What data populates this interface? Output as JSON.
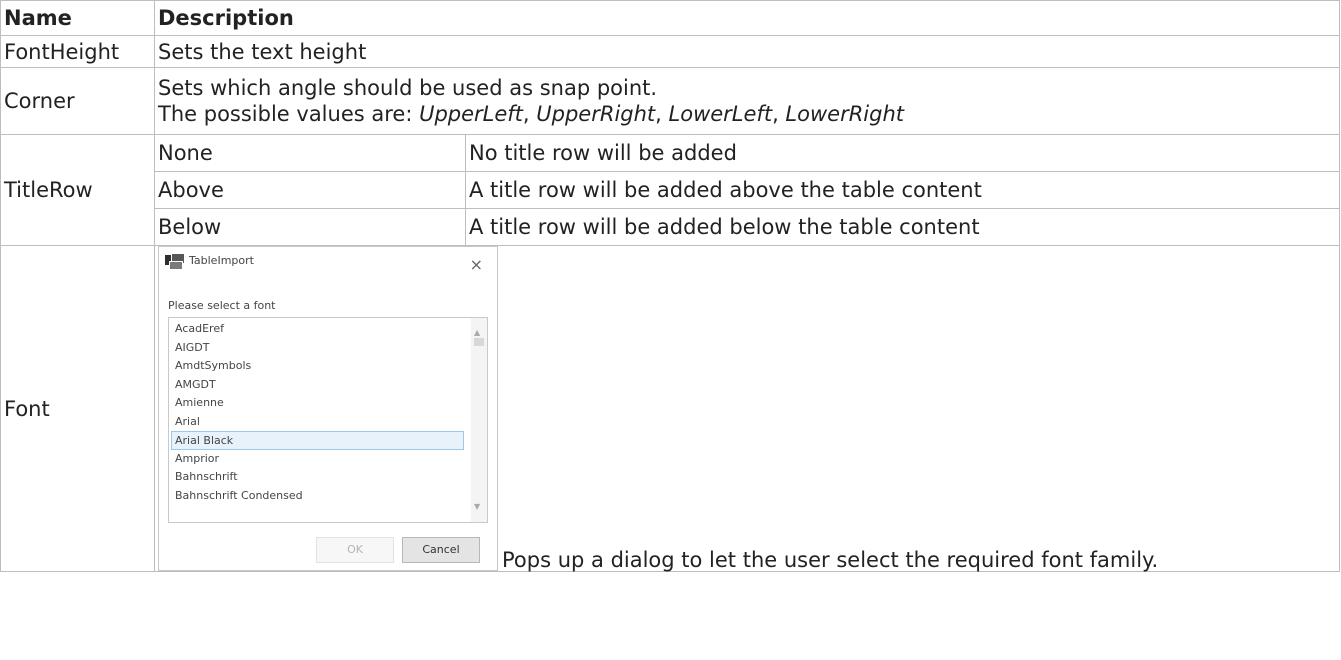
{
  "headers": {
    "name": "Name",
    "description": "Description"
  },
  "rows": {
    "fontheight": {
      "name": "FontHeight",
      "description": "Sets the text height"
    },
    "corner": {
      "name": "Corner",
      "line1": "Sets which angle should be used as snap point.",
      "line2_prefix": "The possible values are: ",
      "values": [
        "UpperLeft",
        "UpperRight",
        "LowerLeft",
        "LowerRight"
      ],
      "sep": ", "
    },
    "titlerow": {
      "name": "TitleRow",
      "options": [
        {
          "value": "None",
          "description": "No title row will be added"
        },
        {
          "value": "Above",
          "description": "A title row will be added above the table content"
        },
        {
          "value": "Below",
          "description": "A title row will be added below the table content"
        }
      ]
    },
    "font": {
      "name": "Font",
      "description": "Pops up a dialog to let the user select the required font family."
    }
  },
  "dialog": {
    "title": "TableImport",
    "close": "×",
    "prompt": "Please select a font",
    "fonts": [
      "AcadEref",
      "AIGDT",
      "AmdtSymbols",
      "AMGDT",
      "Amienne",
      "Arial",
      "Arial Black",
      "Amprior",
      "Bahnschrift",
      "Bahnschrift Condensed"
    ],
    "selected_font": "Arial Black",
    "ok_label": "OK",
    "cancel_label": "Cancel"
  }
}
